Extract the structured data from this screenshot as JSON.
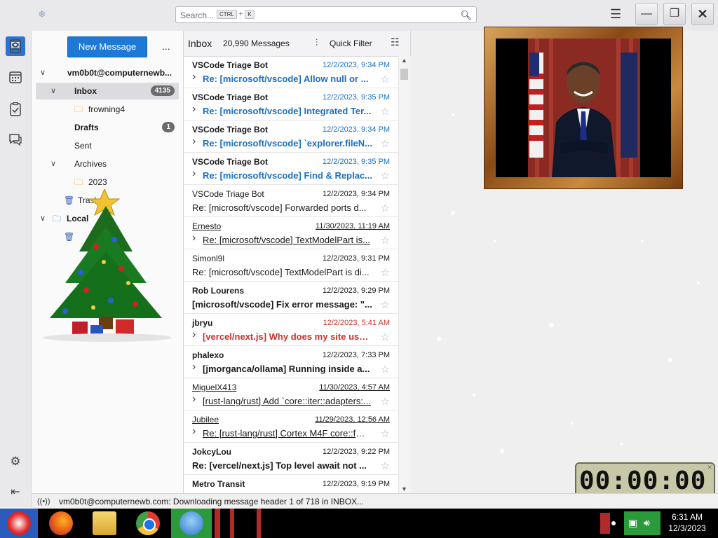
{
  "titlebar": {
    "search_placeholder": "Search...",
    "search_key1": "CTRL",
    "search_plus": "+",
    "search_key2": "K"
  },
  "folder_pane": {
    "new_message_label": "New Message",
    "more_label": "...",
    "account": "vm0b0t@computernewb...",
    "folders": [
      {
        "name": "Inbox",
        "badge": "4135"
      },
      {
        "name": "frowning4",
        "badge": ""
      },
      {
        "name": "Drafts",
        "badge": "1"
      },
      {
        "name": "Sent",
        "badge": ""
      },
      {
        "name": "Archives",
        "badge": ""
      },
      {
        "name": "2023",
        "badge": ""
      },
      {
        "name": "Trash",
        "badge": ""
      },
      {
        "name": "Local",
        "badge": ""
      }
    ]
  },
  "list_header": {
    "folder": "Inbox",
    "count": "20,990 Messages",
    "quick_filter": "Quick Filter"
  },
  "messages": [
    {
      "from": "VSCode Triage Bot",
      "date": "12/2/2023, 9:34 PM",
      "subject": "Re: [microsoft/vscode] Allow null or ...",
      "style": "unread",
      "subject_color": "#1a6fc7",
      "date_color": "#1a6fc7",
      "arrow": true
    },
    {
      "from": "VSCode Triage Bot",
      "date": "12/2/2023, 9:35 PM",
      "subject": "Re: [microsoft/vscode] Integrated Ter...",
      "style": "unread",
      "subject_color": "#1a6fc7",
      "date_color": "#1a6fc7",
      "arrow": true
    },
    {
      "from": "VSCode Triage Bot",
      "date": "12/2/2023, 9:34 PM",
      "subject": "Re: [microsoft/vscode] `explorer.fileN...",
      "style": "unread",
      "subject_color": "#1a6fc7",
      "date_color": "#1a6fc7",
      "arrow": true
    },
    {
      "from": "VSCode Triage Bot",
      "date": "12/2/2023, 9:35 PM",
      "subject": "Re: [microsoft/vscode] Find & Replac...",
      "style": "unread",
      "subject_color": "#1a6fc7",
      "date_color": "#1a6fc7",
      "arrow": true
    },
    {
      "from": "VSCode Triage Bot",
      "date": "12/2/2023, 9:34 PM",
      "subject": "Re: [microsoft/vscode] Forwarded ports d...",
      "style": "read",
      "subject_color": "#1a1a1a",
      "date_color": "#1a1a1a",
      "arrow": false
    },
    {
      "from": "Ernesto",
      "date": "11/30/2023, 11:19 AM",
      "subject": "Re: [microsoft/vscode] TextModelPart is...",
      "style": "link",
      "subject_color": "#1a1a1a",
      "date_color": "#1a1a1a",
      "arrow": true
    },
    {
      "from": "Simonl9l",
      "date": "12/2/2023, 9:31 PM",
      "subject": "Re: [microsoft/vscode] TextModelPart is di...",
      "style": "read",
      "subject_color": "#1a1a1a",
      "date_color": "#1a1a1a",
      "arrow": false
    },
    {
      "from": "Rob Lourens",
      "date": "12/2/2023, 9:29 PM",
      "subject": "[microsoft/vscode] Fix error message: \"...",
      "style": "unread",
      "subject_color": "#1a1a1a",
      "date_color": "#1a1a1a",
      "arrow": false
    },
    {
      "from": "jbryu",
      "date": "12/2/2023, 5:41 AM",
      "subject": "[vercel/next.js] Why does my site use SS...",
      "style": "unread",
      "subject_color": "#c8312b",
      "date_color": "#c8312b",
      "arrow": true
    },
    {
      "from": "phalexo",
      "date": "12/2/2023, 7:33 PM",
      "subject": "[jmorganca/ollama] Running inside a...",
      "style": "unread",
      "subject_color": "#1a1a1a",
      "date_color": "#1a1a1a",
      "arrow": true
    },
    {
      "from": "MiguelX413",
      "date": "11/30/2023, 4:57 AM",
      "subject": "[rust-lang/rust] Add `core::iter::adapters:...",
      "style": "link",
      "subject_color": "#1a1a1a",
      "date_color": "#1a1a1a",
      "arrow": true
    },
    {
      "from": "Jubilee",
      "date": "11/29/2023, 12:56 AM",
      "subject": "Re: [rust-lang/rust] Cortex M4F core::fmt...",
      "style": "link",
      "subject_color": "#1a1a1a",
      "date_color": "#1a1a1a",
      "arrow": true
    },
    {
      "from": "JokcyLou",
      "date": "12/2/2023, 9:22 PM",
      "subject": "Re: [vercel/next.js] Top level await not ...",
      "style": "unread",
      "subject_color": "#1a1a1a",
      "date_color": "#1a1a1a",
      "arrow": false
    },
    {
      "from": "Metro Transit",
      "date": "12/2/2023, 9:19 PM",
      "subject": "",
      "style": "unread",
      "subject_color": "#1a1a1a",
      "date_color": "#1a1a1a",
      "arrow": false
    }
  ],
  "status_bar": {
    "text": "vm0b0t@computernewb.com: Downloading message header 1 of 718 in INBOX..."
  },
  "taskbar": {
    "time": "6:31 AM",
    "date": "12/3/2023"
  },
  "clock_widget": {
    "display": "00:00:00"
  }
}
